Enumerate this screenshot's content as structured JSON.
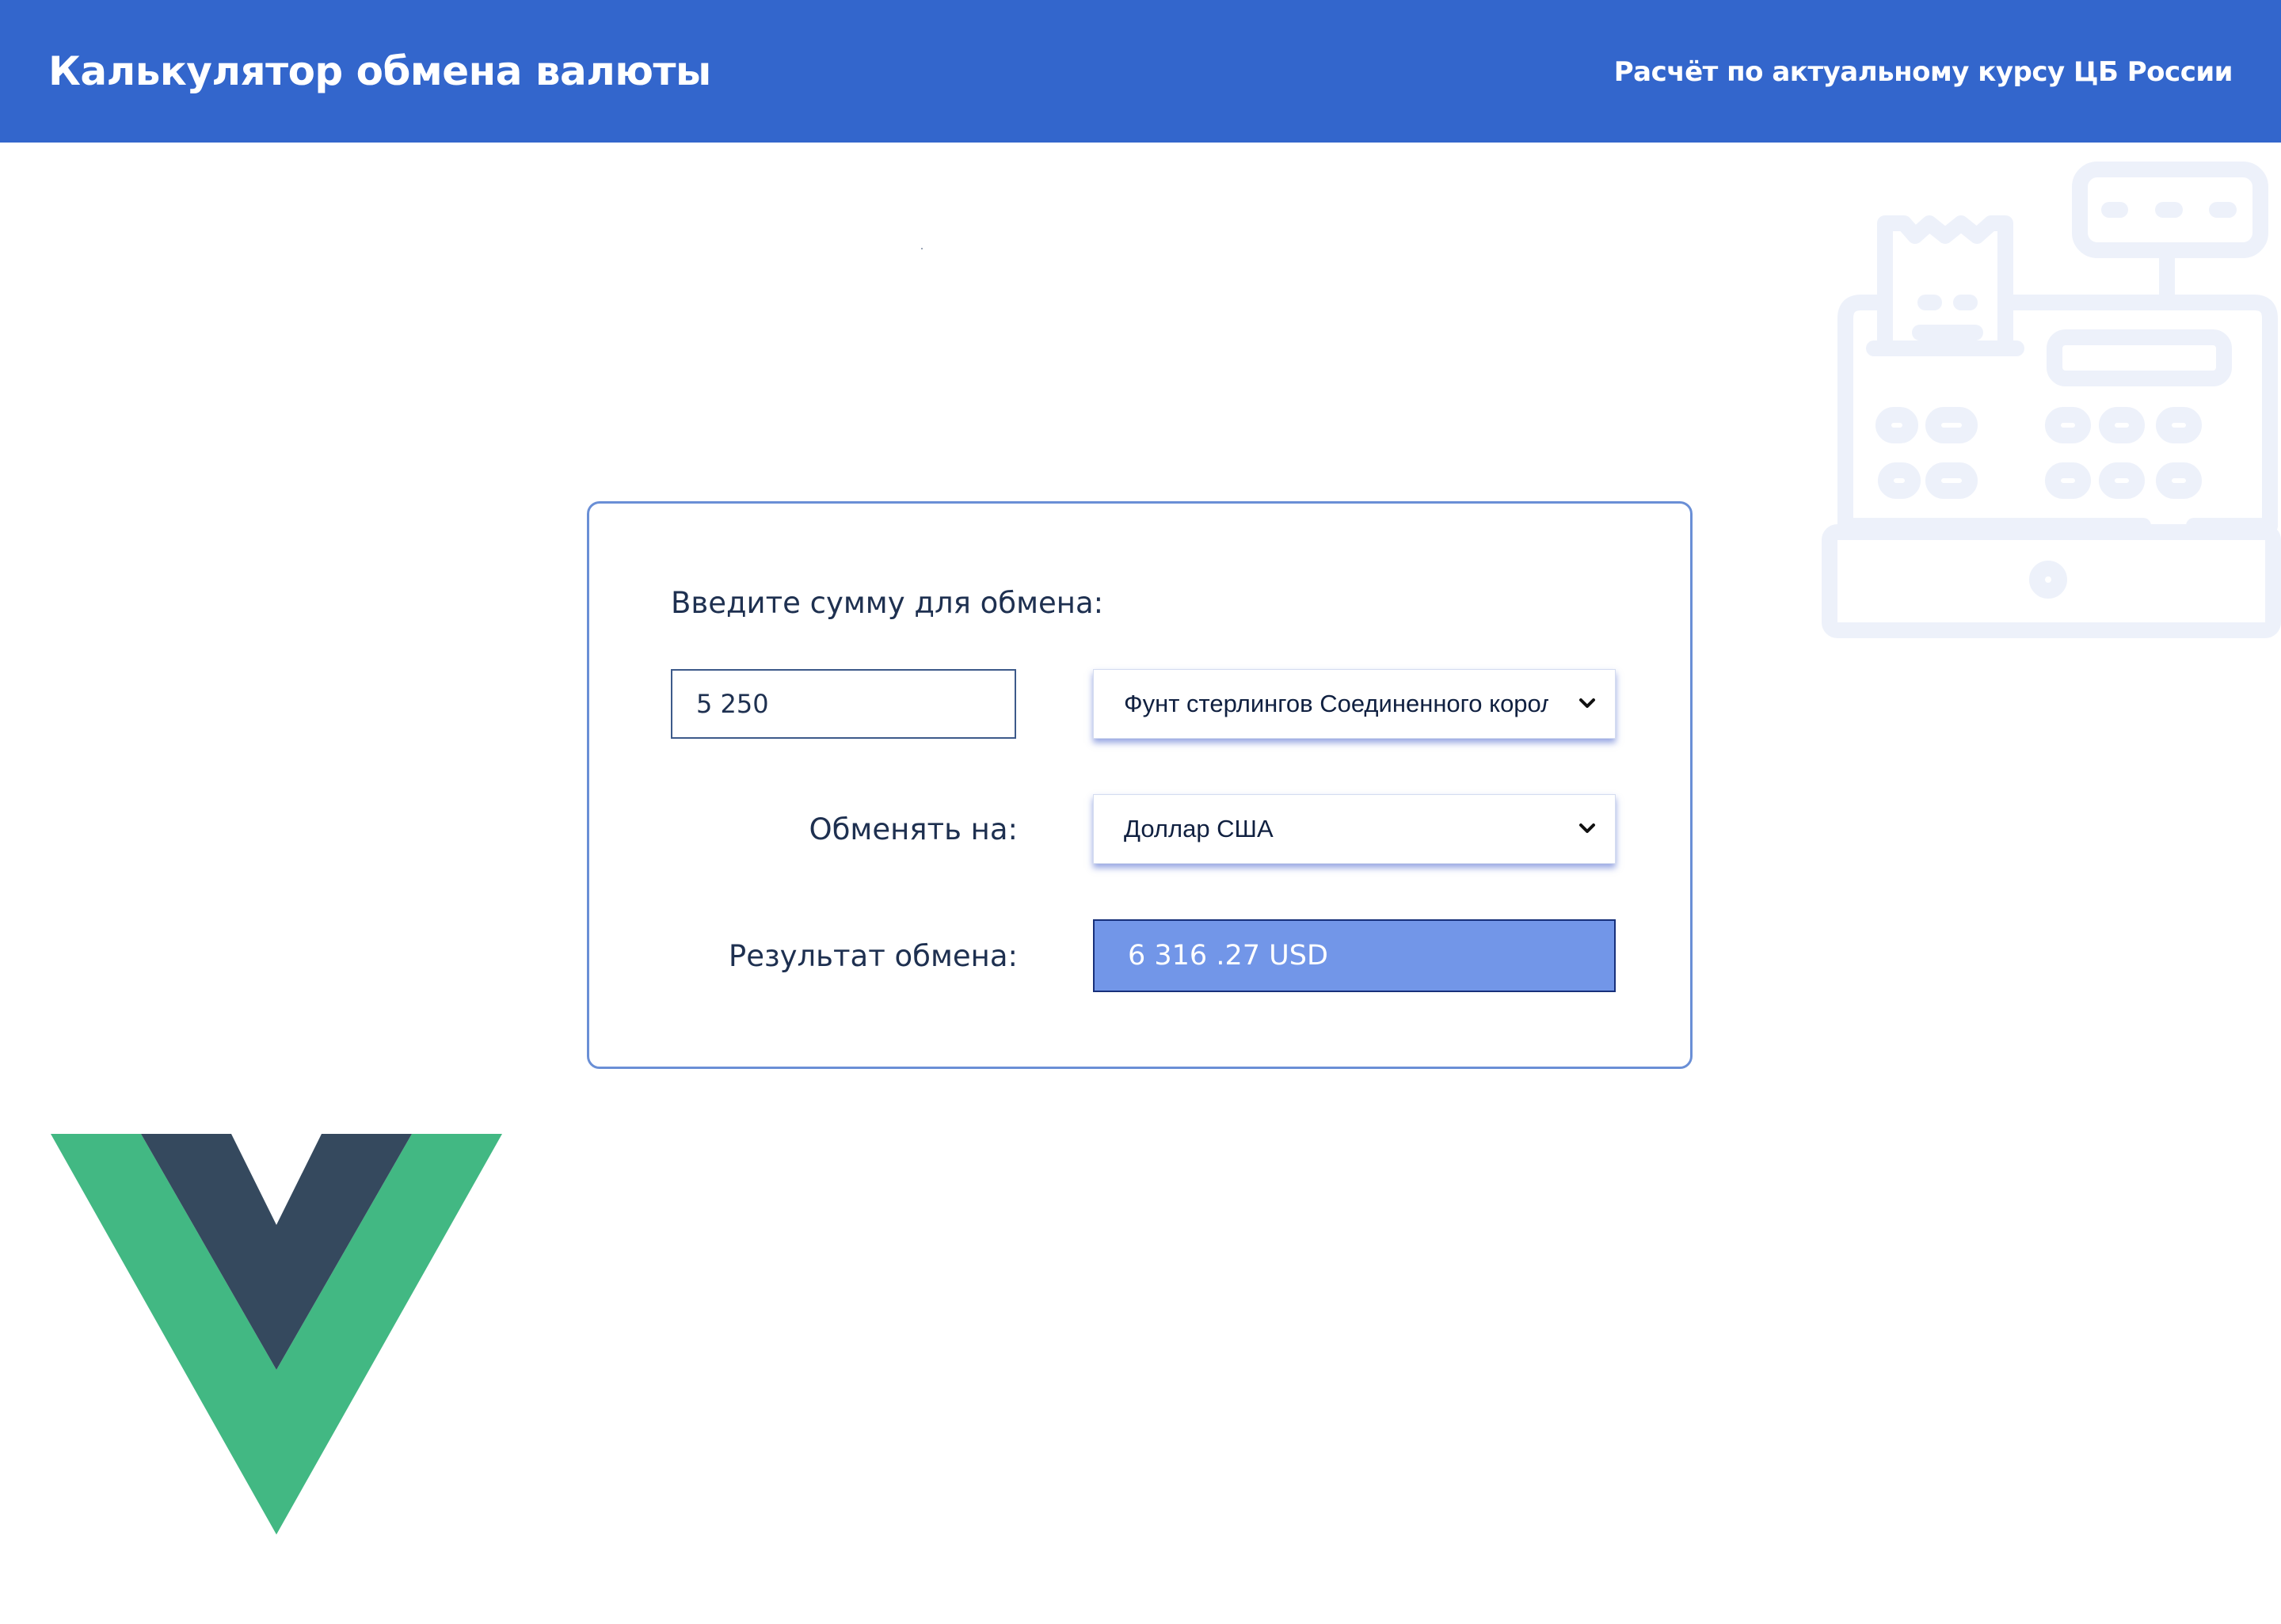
{
  "header": {
    "title": "Калькулятор обмена валюты",
    "subtitle": "Расчёт по актуальному курсу ЦБ России"
  },
  "converter": {
    "amount_label": "Введите сумму для обмена:",
    "amount_value": "5 250",
    "from_currency": "Фунт стерлингов Соединенного королевства",
    "to_label": "Обменять на:",
    "to_currency": "Доллар США",
    "result_label": "Результат обмена:",
    "result_value": "6 316 .27 USD"
  },
  "icons": {
    "background_illustration": "cash-register-icon",
    "logo": "vue-logo",
    "select_arrow": "chevron-down-icon"
  },
  "colors": {
    "header_bg": "#3366cc",
    "card_border": "#6a8fd6",
    "result_bg": "#7296e8",
    "vue_green": "#42b883",
    "vue_dark": "#35495e",
    "illustration": "#edf1fa"
  }
}
